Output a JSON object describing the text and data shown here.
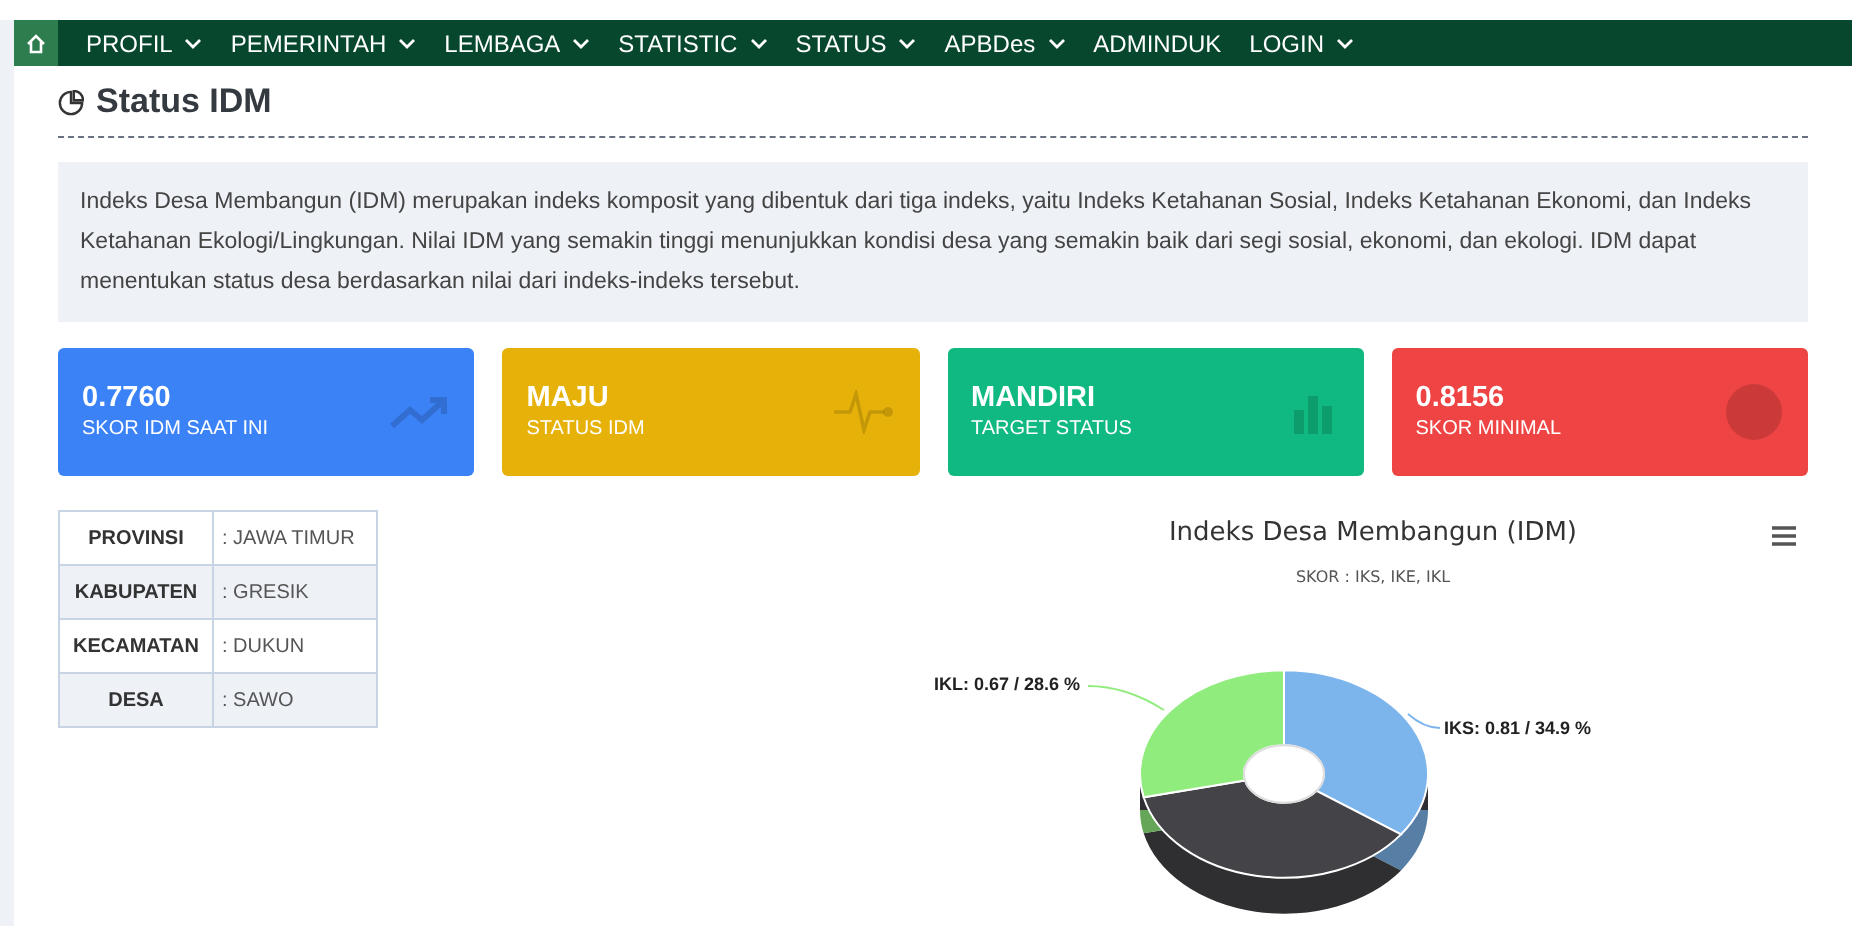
{
  "nav": {
    "items": [
      {
        "label": "PROFIL",
        "dropdown": true
      },
      {
        "label": "PEMERINTAH",
        "dropdown": true
      },
      {
        "label": "LEMBAGA",
        "dropdown": true
      },
      {
        "label": "STATISTIC",
        "dropdown": true
      },
      {
        "label": "STATUS",
        "dropdown": true
      },
      {
        "label": "APBDes",
        "dropdown": true
      },
      {
        "label": "ADMINDUK",
        "dropdown": false
      },
      {
        "label": "LOGIN",
        "dropdown": true
      }
    ]
  },
  "page_title": "Status IDM",
  "description": "Indeks Desa Membangun (IDM) merupakan indeks komposit yang dibentuk dari tiga indeks, yaitu Indeks Ketahanan Sosial, Indeks Ketahanan Ekonomi, dan Indeks Ketahanan Ekologi/Lingkungan. Nilai IDM yang semakin tinggi menunjukkan kondisi desa yang semakin baik dari segi sosial, ekonomi, dan ekologi. IDM dapat menentukan status desa berdasarkan nilai dari indeks-indeks tersebut.",
  "cards": [
    {
      "value": "0.7760",
      "label": "SKOR IDM SAAT INI",
      "color": "#3b82f6",
      "kind": "trend"
    },
    {
      "value": "MAJU",
      "label": "STATUS IDM",
      "color": "#e6b20a",
      "kind": "pulse"
    },
    {
      "value": "MANDIRI",
      "label": "TARGET STATUS",
      "color": "#10b981",
      "kind": "bars"
    },
    {
      "value": "0.8156",
      "label": "SKOR MINIMAL",
      "color": "#ef4444",
      "kind": "pie"
    }
  ],
  "location_table": {
    "rows": [
      {
        "label": "PROVINSI",
        "value": ": JAWA TIMUR"
      },
      {
        "label": "KABUPATEN",
        "value": ": GRESIK"
      },
      {
        "label": "KECAMATAN",
        "value": ": DUKUN"
      },
      {
        "label": "DESA",
        "value": ": SAWO"
      }
    ]
  },
  "chart": {
    "chart_data": {
      "type": "pie",
      "title": "Indeks Desa Membangun (IDM)",
      "subtitle": "SKOR : IKS, IKE, IKL",
      "values": [
        34.9,
        36.5,
        28.6
      ],
      "colors": [
        "#7cb5ec",
        "#434348",
        "#90ed7d"
      ],
      "value_labels": [
        "IKS: 0.81 / 34.9 %",
        null,
        "IKL: 0.67 / 28.6 %"
      ]
    }
  }
}
